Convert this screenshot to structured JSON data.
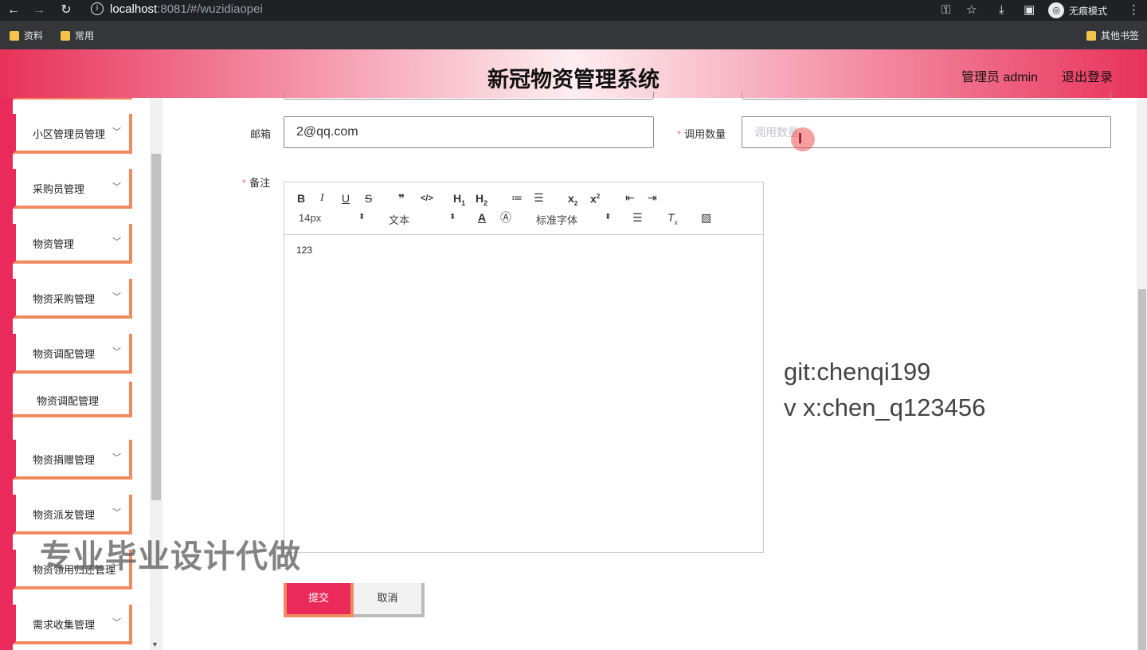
{
  "browser": {
    "url_host": "localhost",
    "url_path": ":8081/#/wuzidiaopei",
    "incognito_label": "无痕模式",
    "bookmarks": [
      "资料",
      "常用"
    ],
    "other_bookmarks": "其他书签"
  },
  "header": {
    "title": "新冠物资管理系统",
    "admin_label": "管理员 admin",
    "logout": "退出登录"
  },
  "sidebar": {
    "items": [
      {
        "label": "小区管理员管理"
      },
      {
        "label": "采购员管理"
      },
      {
        "label": "物资管理"
      },
      {
        "label": "物资采购管理"
      },
      {
        "label": "物资调配管理"
      },
      {
        "label": "物资捐赠管理"
      },
      {
        "label": "物资派发管理"
      },
      {
        "label": "物资领用归还管理"
      },
      {
        "label": "需求收集管理"
      }
    ],
    "sub_item": "物资调配管理"
  },
  "form": {
    "email_label": "邮箱",
    "email_value": "2@qq.com",
    "quantity_label": "调用数量",
    "quantity_placeholder": "调用数量",
    "remark_label": "备注",
    "editor": {
      "font_size": "14px",
      "block_type": "文本",
      "font_family": "标准字体",
      "content": "123"
    },
    "submit": "提交",
    "cancel": "取消"
  },
  "contact": {
    "git": "git:chenqi199",
    "wx": "v x:chen_q123456"
  },
  "watermark": "专业毕业设计代做"
}
